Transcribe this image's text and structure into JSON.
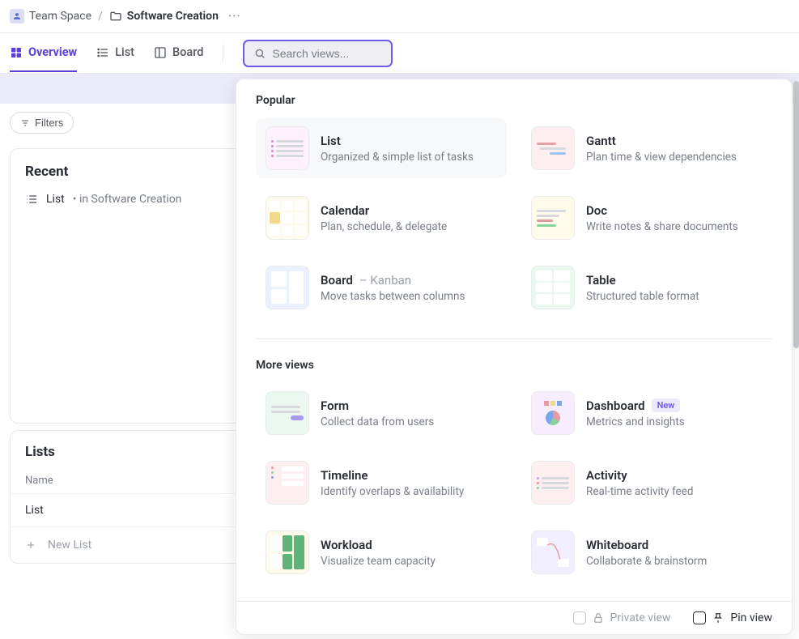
{
  "breadcrumb": {
    "space_label": "Team Space",
    "folder_label": "Software Creation"
  },
  "tabs": {
    "overview": "Overview",
    "list": "List",
    "board": "Board"
  },
  "search": {
    "placeholder": "Search views..."
  },
  "toolbar": {
    "filters_label": "Filters"
  },
  "recent": {
    "title": "Recent",
    "items": [
      {
        "name": "List",
        "location": "in Software Creation"
      }
    ]
  },
  "lists_section": {
    "title": "Lists",
    "header_name": "Name",
    "rows": [
      {
        "name": "List"
      }
    ],
    "new_list_label": "New List"
  },
  "dropdown": {
    "sections": {
      "popular": {
        "label": "Popular",
        "items": [
          {
            "title": "List",
            "desc": "Organized & simple list of tasks",
            "highlighted": true,
            "thumb_bg": "#fdf2fb"
          },
          {
            "title": "Gantt",
            "desc": "Plan time & view dependencies",
            "thumb_bg": "#fdeff0"
          },
          {
            "title": "Calendar",
            "desc": "Plan, schedule, & delegate",
            "thumb_bg": "#fffbea"
          },
          {
            "title": "Doc",
            "desc": "Write notes & share documents",
            "thumb_bg": "#fffbea"
          },
          {
            "title": "Board",
            "suffix": "– Kanban",
            "desc": "Move tasks between columns",
            "thumb_bg": "#ebf2ff"
          },
          {
            "title": "Table",
            "desc": "Structured table format",
            "thumb_bg": "#eaf8ef"
          }
        ]
      },
      "more": {
        "label": "More views",
        "items": [
          {
            "title": "Form",
            "desc": "Collect data from users",
            "thumb_bg": "#eaf8ef"
          },
          {
            "title": "Dashboard",
            "badge": "New",
            "desc": "Metrics and insights",
            "thumb_bg": "#f6edff"
          },
          {
            "title": "Timeline",
            "desc": "Identify overlaps & availability",
            "thumb_bg": "#fdeff0"
          },
          {
            "title": "Activity",
            "desc": "Real-time activity feed",
            "thumb_bg": "#fdeff0"
          },
          {
            "title": "Workload",
            "desc": "Visualize team capacity",
            "thumb_bg": "#fffbea"
          },
          {
            "title": "Whiteboard",
            "desc": "Collaborate & brainstorm",
            "thumb_bg": "#f1eeff"
          }
        ]
      }
    },
    "footer": {
      "private_view": "Private view",
      "pin_view": "Pin view"
    }
  }
}
